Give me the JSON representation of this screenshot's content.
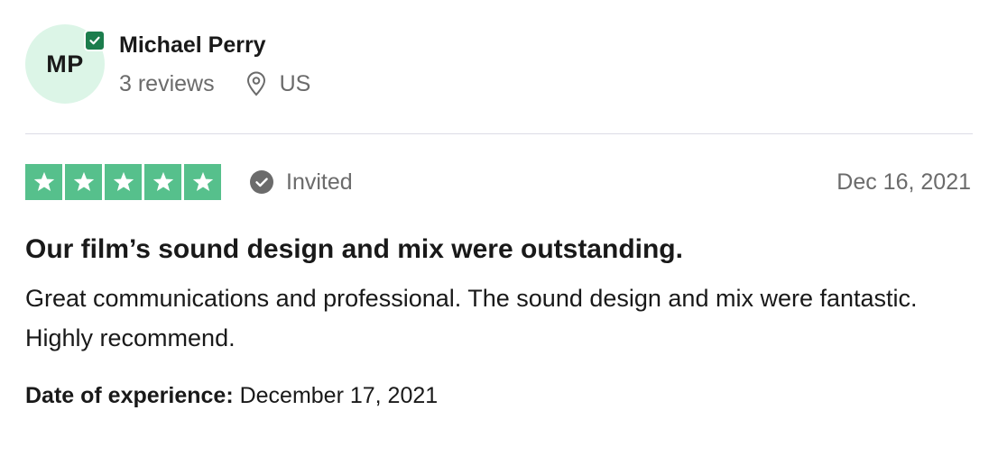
{
  "reviewer": {
    "initials": "MP",
    "name": "Michael Perry",
    "review_count": "3 reviews",
    "location": "US",
    "verified_icon": "check-badge-icon",
    "location_icon": "map-pin-icon"
  },
  "rating": {
    "stars": 5,
    "max_stars": 5,
    "star_color": "#56C08C",
    "status": "Invited",
    "status_icon": "check-circle-icon"
  },
  "review": {
    "date": "Dec 16, 2021",
    "title": "Our film’s sound design and mix were outstanding.",
    "body": "Great communications and professional. The sound design and mix were fantastic. Highly recommend.",
    "experience_label": "Date of experience:",
    "experience_date": "December 17, 2021"
  },
  "colors": {
    "avatar_bg": "#DCF5E7",
    "verified_badge": "#1C7D4D",
    "muted_text": "#6B6B6B",
    "divider": "#DCDCE6"
  }
}
